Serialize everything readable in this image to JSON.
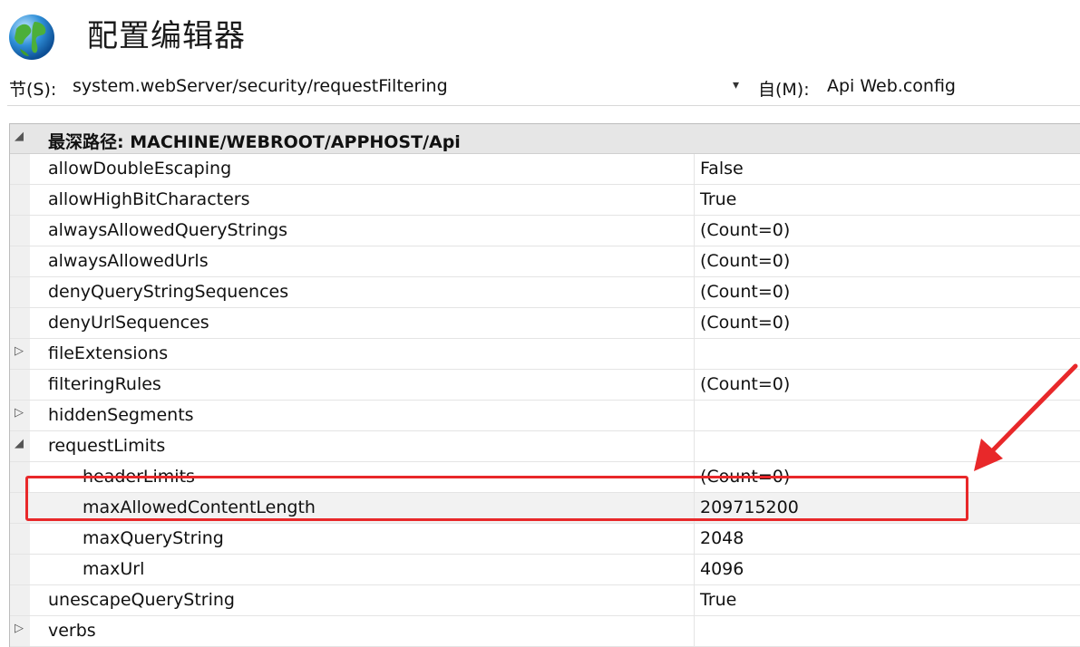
{
  "window": {
    "title": "配置编辑器",
    "icon": "globe-icon"
  },
  "section": {
    "label": "节(S):",
    "value": "system.webServer/security/requestFiltering",
    "from_label": "自(M):",
    "from_value": "Api Web.config"
  },
  "grid": {
    "group_label": "最深路径: MACHINE/WEBROOT/APPHOST/Api",
    "rows": [
      {
        "name": "allowDoubleEscaping",
        "value": "False"
      },
      {
        "name": "allowHighBitCharacters",
        "value": "True"
      },
      {
        "name": "alwaysAllowedQueryStrings",
        "value": "(Count=0)"
      },
      {
        "name": "alwaysAllowedUrls",
        "value": "(Count=0)"
      },
      {
        "name": "denyQueryStringSequences",
        "value": "(Count=0)"
      },
      {
        "name": "denyUrlSequences",
        "value": "(Count=0)"
      },
      {
        "name": "fileExtensions",
        "value": ""
      },
      {
        "name": "filteringRules",
        "value": "(Count=0)"
      },
      {
        "name": "hiddenSegments",
        "value": ""
      },
      {
        "name": "requestLimits",
        "value": ""
      },
      {
        "name": "headerLimits",
        "value": "(Count=0)"
      },
      {
        "name": "maxAllowedContentLength",
        "value": "209715200"
      },
      {
        "name": "maxQueryString",
        "value": "2048"
      },
      {
        "name": "maxUrl",
        "value": "4096"
      },
      {
        "name": "unescapeQueryString",
        "value": "True"
      },
      {
        "name": "verbs",
        "value": ""
      }
    ]
  },
  "annotation": {
    "color": "#e8282a"
  }
}
